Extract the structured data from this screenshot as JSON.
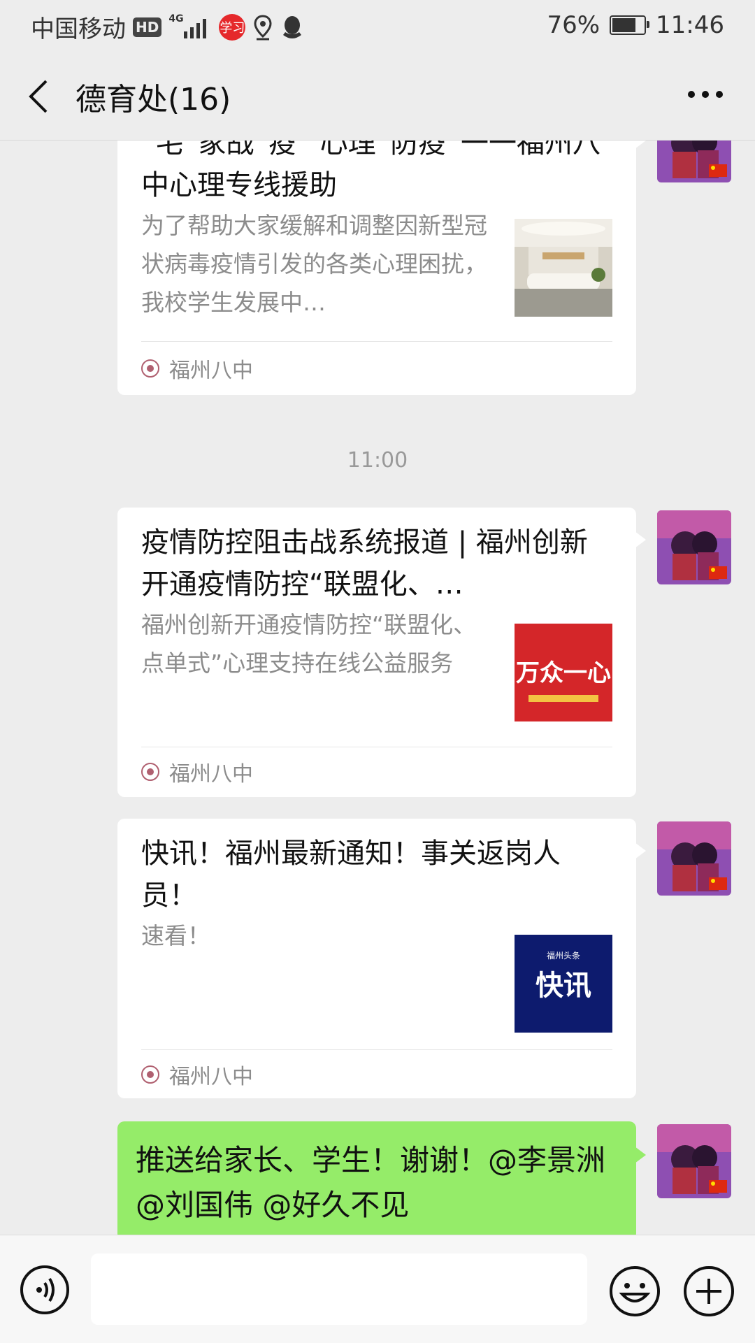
{
  "status_bar": {
    "carrier": "中国移动",
    "hd_badge": "HD",
    "network_type": "4G",
    "app_badge": "学习",
    "battery_percent": "76%",
    "battery_level": 0.76,
    "time": "11:46"
  },
  "title_bar": {
    "title": "德育处(16)"
  },
  "messages": [
    {
      "type": "article",
      "title": "“宅”家战“疫” 心理“防疫”一一福州八中心理专线援助",
      "desc": "为了帮助大家缓解和调整因新型冠状病毒疫情引发的各类心理困扰，我校学生发展中…",
      "source": "福州八中",
      "thumb_icon": "lounge-photo"
    },
    {
      "type": "time",
      "label": "11:00"
    },
    {
      "type": "article",
      "title": "疫情防控阻击战系统报道 | 福州创新开通疫情防控“联盟化、…",
      "desc": "福州创新开通疫情防控“联盟化、点单式”心理支持在线公益服务",
      "source": "福州八中",
      "thumb_icon": "poster-red",
      "thumb_text": "万众一心"
    },
    {
      "type": "article",
      "title": "快讯！福州最新通知！事关返岗人员！",
      "desc": "速看！",
      "source": "福州八中",
      "thumb_icon": "poster-blue",
      "thumb_text": "快讯",
      "thumb_subtext": "福州头条"
    },
    {
      "type": "text",
      "text": "推送给家长、学生！谢谢！@李景洲 @刘国伟 @好久不见"
    }
  ],
  "input_bar": {
    "placeholder": ""
  },
  "colors": {
    "background": "#ededed",
    "bubble_green": "#95ec69",
    "card_white": "#ffffff",
    "secondary_text": "#8c8c8c"
  }
}
